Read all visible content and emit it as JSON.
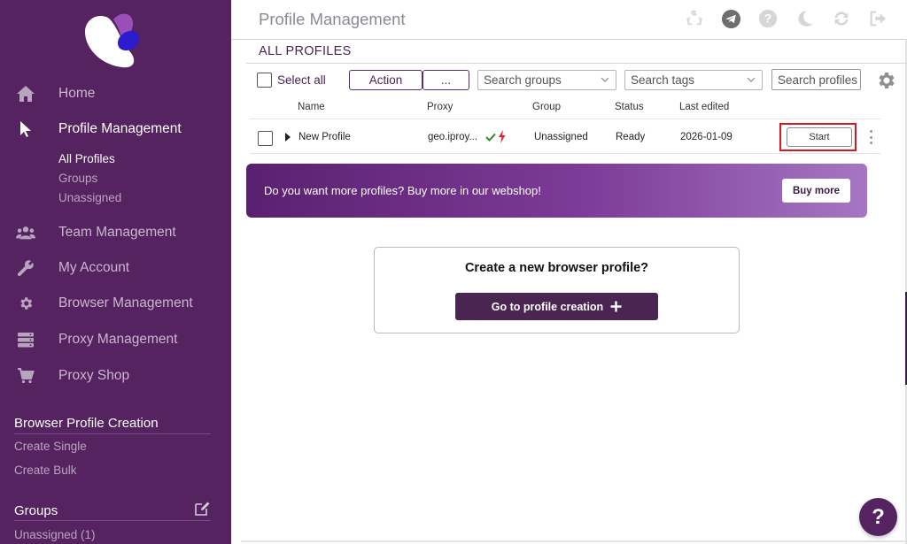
{
  "sidebar": {
    "nav": [
      {
        "label": "Home",
        "icon": "home-icon"
      },
      {
        "label": "Profile Management",
        "icon": "cursor-arrow-icon"
      },
      {
        "label": "Team Management",
        "icon": "users-icon"
      },
      {
        "label": "My Account",
        "icon": "wrench-icon"
      },
      {
        "label": "Browser Management",
        "icon": "gear-icon"
      },
      {
        "label": "Proxy Management",
        "icon": "server-icon"
      },
      {
        "label": "Proxy Shop",
        "icon": "cart-icon"
      }
    ],
    "profile_sub": [
      "All Profiles",
      "Groups",
      "Unassigned"
    ],
    "creation_title": "Browser Profile Creation",
    "creation_links": [
      "Create Single",
      "Create Bulk"
    ],
    "groups_title": "Groups",
    "groups_links": [
      "Unassigned (1)"
    ]
  },
  "header": {
    "title": "Profile Management",
    "icons": [
      "recycle-icon",
      "telegram-icon",
      "help-circle-icon",
      "moon-icon",
      "refresh-icon",
      "logout-icon"
    ]
  },
  "main": {
    "subtitle": "ALL PROFILES",
    "select_all": "Select all",
    "action_label": "Action",
    "more_label": "...",
    "search_groups": "Search groups",
    "search_tags": "Search tags",
    "search_profiles": "Search profiles (",
    "columns": [
      "Name",
      "Proxy",
      "Group",
      "Status",
      "Last edited"
    ],
    "rows": [
      {
        "name": "New Profile",
        "proxy": "geo.iproy...",
        "group": "Unassigned",
        "status": "Ready",
        "last_edited": "2026-01-09",
        "action": "Start"
      }
    ]
  },
  "banner": {
    "text": "Do you want more profiles? Buy more in our webshop!",
    "button": "Buy more"
  },
  "create_card": {
    "title": "Create a new browser profile?",
    "button": "Go to profile creation"
  },
  "help_button": "?",
  "colors": {
    "sidebar_bg": "#55235f",
    "accent": "#4b2552",
    "highlight_border": "#d6181f",
    "check_green": "#2e8b2e",
    "bolt_red": "#e0202a"
  }
}
